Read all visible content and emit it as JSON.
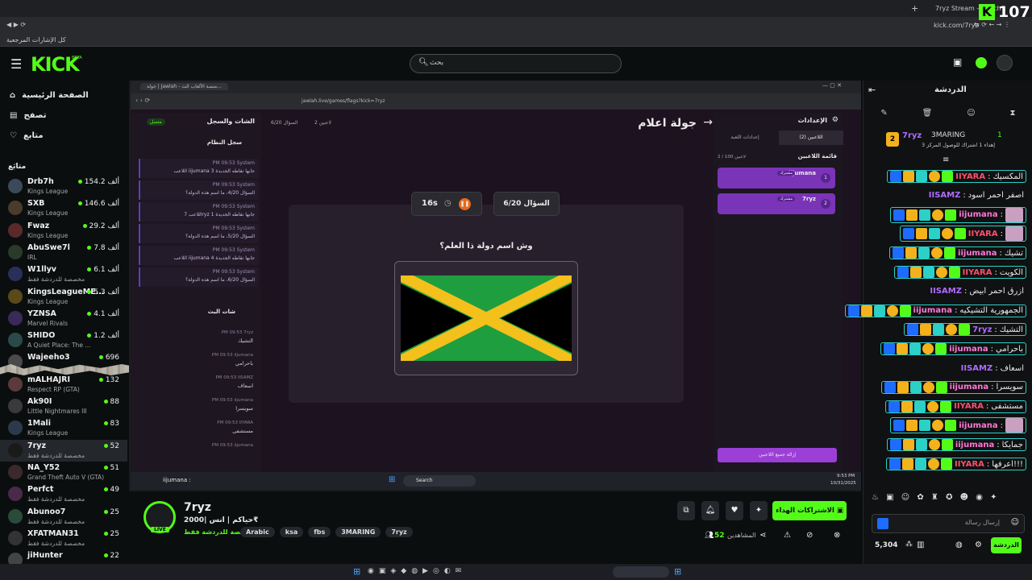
{
  "browser": {
    "tab_title": "7ryz Stream - Watch",
    "url": "kick.com/7ryz",
    "bookmarks_label": "كل الإشارات المرجعية"
  },
  "overlay_counter": "107",
  "kick": {
    "logo": "KICK",
    "logo_beta": "BETA",
    "search_placeholder": "بحث"
  },
  "sidebar": {
    "nav": [
      {
        "label": "الصفحة الرئيسية",
        "icon": "home-icon"
      },
      {
        "label": "تصفح",
        "icon": "browse-icon"
      },
      {
        "label": "متابع",
        "icon": "heart-icon"
      }
    ],
    "following_header": "متابَع",
    "channels": [
      {
        "name": "Drb7h",
        "category": "Kings League",
        "viewers": "154.2 ألف"
      },
      {
        "name": "SXB",
        "category": "Kings League",
        "viewers": "146.6 ألف"
      },
      {
        "name": "Fwaz",
        "category": "Kings League",
        "viewers": "29.2 ألف"
      },
      {
        "name": "AbuSwe7l",
        "category": "IRL",
        "viewers": "7.8 ألف"
      },
      {
        "name": "W1llyv",
        "category": "مخصصة للدردشة فقط",
        "viewers": "6.1 ألف"
      },
      {
        "name": "KingsLeagueME...",
        "category": "Kings League",
        "viewers": "5.3 ألف"
      },
      {
        "name": "YZNSA",
        "category": "Marvel Rivals",
        "viewers": "4.1 ألف"
      },
      {
        "name": "SHIDO",
        "category": "A Quiet Place: The ...",
        "viewers": "1.2 ألف"
      },
      {
        "name": "Wajeeho3",
        "category": "",
        "viewers": "696"
      },
      {
        "name": "mALHAJRI",
        "category": "Respect RP (GTA)",
        "viewers": "132"
      },
      {
        "name": "Ak90I",
        "category": "Little Nightmares III",
        "viewers": "88"
      },
      {
        "name": "1Mali",
        "category": "Kings League",
        "viewers": "83"
      },
      {
        "name": "7ryz",
        "category": "مخصصة للدردشة فقط",
        "viewers": "52"
      },
      {
        "name": "NA_Y52",
        "category": "Grand Theft Auto V (GTA)",
        "viewers": "51"
      },
      {
        "name": "Perfct",
        "category": "مخصصة للدردشة فقط",
        "viewers": "49"
      },
      {
        "name": "Abunoo7",
        "category": "مخصصة للدردشة فقط",
        "viewers": "25"
      },
      {
        "name": "XFATMAN31",
        "category": "مخصصة للدردشة فقط",
        "viewers": "25"
      },
      {
        "name": "jiHunter",
        "category": "",
        "viewers": "22"
      }
    ]
  },
  "inner_browser": {
    "tab_title": "جولة | Jawlah - منصة الألعاب الث...",
    "url": "jawlah.live/games/flags?kick=7ryz"
  },
  "game": {
    "title": "جولة اعلام",
    "players_meta": "2 لاعبين",
    "question_meta": "السؤال 6/20",
    "question_counter": "السؤال 6/20",
    "timer": "16s",
    "question": "وش اسم دولة ذا العلم؟",
    "settings_title": "الإعدادات",
    "tab_players": "اللاعبين (2)",
    "tab_game_settings": "إعدادات اللعبة",
    "players_list_title": "قائمة اللاعبين",
    "players_count": "2 / 100 لاعبين",
    "players": [
      {
        "rank": "1",
        "name": "iijumana",
        "role": "مشترك"
      },
      {
        "rank": "2",
        "name": "7ryz",
        "role": "مشترك"
      }
    ],
    "remove_all_button": "إزالة جميع اللاعبين",
    "chat_panel_title": "الشات والسجل",
    "connected_label": "متصل",
    "system_log_title": "سجل النظام",
    "system_messages": [
      {
        "time": "PM 09:53",
        "sender": "System",
        "text": "اللاعب iijumana جابها نقاطه الجديدة 3"
      },
      {
        "time": "PM 09:53",
        "sender": "System",
        "text": "السؤال 4/20، ما اسم هذه الدولة؟"
      },
      {
        "time": "PM 09:53",
        "sender": "System",
        "text": "اللاعب 7ryz جابها نقاطه الجديدة 1"
      },
      {
        "time": "PM 09:53",
        "sender": "System",
        "text": "السؤال 5/20، ما اسم هذه الدولة؟"
      },
      {
        "time": "PM 09:53",
        "sender": "System",
        "text": "اللاعب iijumana جابها نقاطه الجديدة 4"
      },
      {
        "time": "PM 09:53",
        "sender": "System",
        "text": "السؤال 6/20، ما اسم هذه الدولة؟"
      }
    ],
    "live_chat_title": "شات البث",
    "live_chat": [
      {
        "time": "PM 09:53",
        "user": "7ryz",
        "text": "التشيك"
      },
      {
        "time": "PM 09:53",
        "user": "iijumana",
        "text": "باحرامي"
      },
      {
        "time": "PM 09:53",
        "user": "IISAMZ",
        "text": "اسعاف"
      },
      {
        "time": "PM 09:53",
        "user": "iijumana",
        "text": "سويسرا"
      },
      {
        "time": "PM 09:53",
        "user": "IIYARA",
        "text": "مستشفى"
      },
      {
        "time": "PM 09:53",
        "user": "iijumana",
        "text": ""
      }
    ],
    "chat_ticker_user": "iijumana :"
  },
  "inner_taskbar": {
    "search": "Search",
    "time": "9:53 PM",
    "date": "10/31/2025"
  },
  "stream_info": {
    "channel": "7ryz",
    "live_badge": "LIVE",
    "title": "حياكم | انس |2000₹",
    "category": "مخصصة للدردشة فقط",
    "tags": [
      "Arabic",
      "ksa",
      "fbs",
      "3MARING",
      "7ryz"
    ],
    "subscribe_button": "الاشتراكات الهداء",
    "viewers_label": "المشاهدين",
    "viewers": "52"
  },
  "chat": {
    "title": "الدردشة",
    "pinned": {
      "user": "7ryz",
      "level": "2",
      "gifter": "3MARING",
      "gifter_count": "1",
      "message": "إهداء 1 اشتراك للوصول المركز 3"
    },
    "messages": [
      {
        "user": "IIYARA",
        "text": "المكسيك",
        "color": "#ff4d6d",
        "badges": true
      },
      {
        "user": "IISAMZ",
        "text": "اصفر احمر اسود",
        "color": "#b06cff",
        "badges": false
      },
      {
        "user": "iijumana",
        "text": "",
        "color": "#ff78d5",
        "badges": true
      },
      {
        "user": "IIYARA",
        "text": "",
        "color": "#ff4d6d",
        "badges": true
      },
      {
        "user": "iijumana",
        "text": "تشيك",
        "color": "#ff78d5",
        "badges": true
      },
      {
        "user": "IIYARA",
        "text": "الكويت",
        "color": "#ff4d6d",
        "badges": true
      },
      {
        "user": "IISAMZ",
        "text": "ازرق احمر ابيض",
        "color": "#b06cff",
        "badges": false
      },
      {
        "user": "iijumana",
        "text": "الجمهورية التشيكيه",
        "color": "#ff78d5",
        "badges": true
      },
      {
        "user": "7ryz",
        "text": "التشيك",
        "color": "#b06cff",
        "badges": true
      },
      {
        "user": "iijumana",
        "text": "باحرامي",
        "color": "#ff78d5",
        "badges": true
      },
      {
        "user": "IISAMZ",
        "text": "اسعاف",
        "color": "#b06cff",
        "badges": false
      },
      {
        "user": "iijumana",
        "text": "سويسرا",
        "color": "#ff78d5",
        "badges": true
      },
      {
        "user": "IIYARA",
        "text": "مستشفى",
        "color": "#ff4d6d",
        "badges": true
      },
      {
        "user": "iijumana",
        "text": "",
        "color": "#ff78d5",
        "badges": true
      },
      {
        "user": "iijumana",
        "text": "جمايكا",
        "color": "#ff78d5",
        "badges": true
      },
      {
        "user": "IIYARA",
        "text": "اعرفها!!!",
        "color": "#ff4d6d",
        "badges": true
      }
    ],
    "input_placeholder": "إرسال رسالة",
    "points": "5,304",
    "send_button": "الدردشة"
  },
  "colors": {
    "kick_green": "#53fc18",
    "game_purple": "#9b3fd6",
    "flag_green": "#1f9e3f",
    "flag_yellow": "#f3c01c",
    "flag_black": "#000000"
  }
}
